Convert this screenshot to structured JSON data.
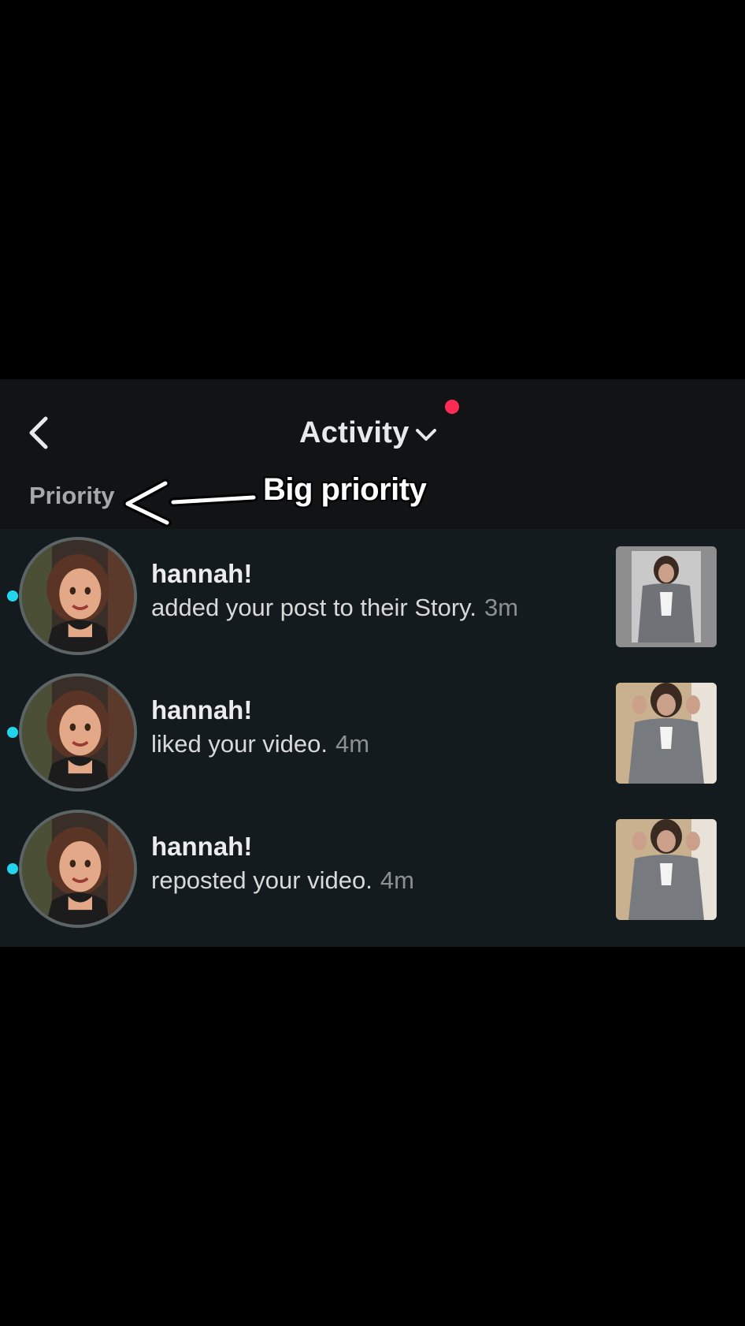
{
  "header": {
    "title": "Activity",
    "back_icon": "chevron-left-icon",
    "dropdown_icon": "chevron-down-icon",
    "has_notification_dot": true,
    "notification_dot_color": "#fe2c55"
  },
  "section": {
    "label": "Priority"
  },
  "annotation": {
    "text": "Big priority",
    "arrow_icon": "hand-drawn-arrow-left-icon"
  },
  "colors": {
    "panel_bg": "#121314",
    "list_bg": "#141b1e",
    "unread_dot": "#20d5ec",
    "text_primary": "#ececec",
    "text_secondary": "#8d8f91"
  },
  "notifications": [
    {
      "username": "hannah!",
      "action": "added your post to their Story.",
      "time": "3m",
      "unread": true
    },
    {
      "username": "hannah!",
      "action": "liked your video.",
      "time": "4m",
      "unread": true
    },
    {
      "username": "hannah!",
      "action": "reposted your video.",
      "time": "4m",
      "unread": true
    }
  ]
}
